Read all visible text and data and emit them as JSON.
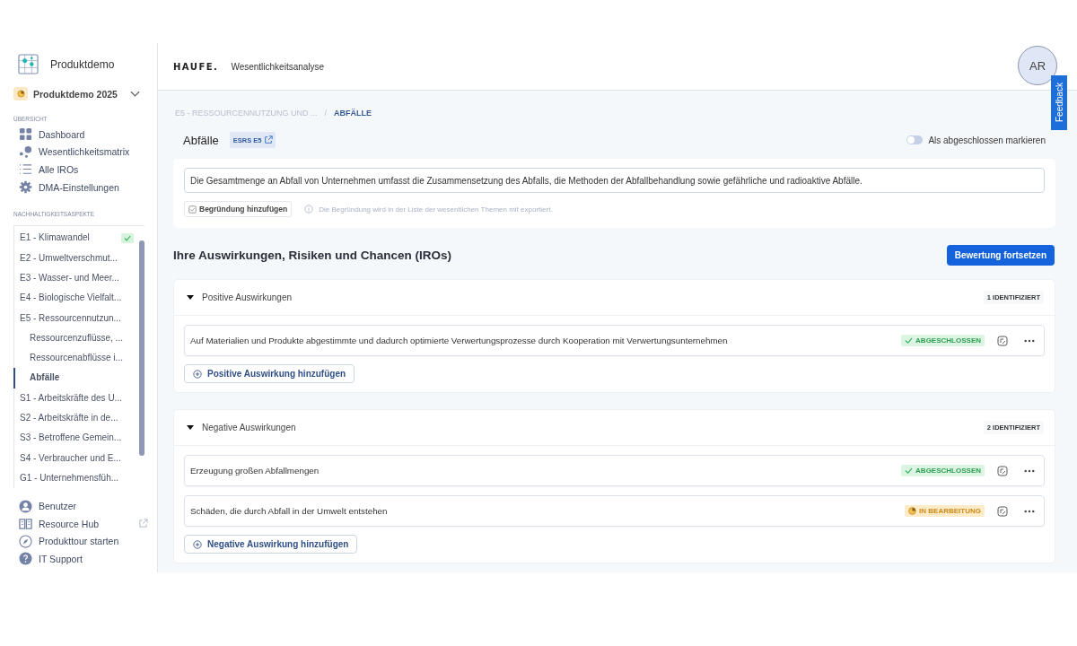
{
  "sidebar": {
    "workspace": "Produktdemo",
    "project": "Produktdemo 2025",
    "overview_heading": "ÜBERSICHT",
    "nav": [
      {
        "label": "Dashboard"
      },
      {
        "label": "Wesentlichkeitsmatrix"
      },
      {
        "label": "Alle IROs"
      },
      {
        "label": "DMA-Einstellungen"
      }
    ],
    "aspects_heading": "NACHHALTIGKEITSASPEKTE",
    "aspects": [
      {
        "label": "E1 - Klimawandel",
        "completed": true,
        "selected": false
      },
      {
        "label": "E2 - Umweltverschmut...",
        "completed": false,
        "selected": false
      },
      {
        "label": "E3 - Wasser- und Meer...",
        "completed": false,
        "selected": false
      },
      {
        "label": "E4 - Biologische Vielfalt...",
        "completed": false,
        "selected": false
      },
      {
        "label": "E5 - Ressourcennutzun...",
        "completed": false,
        "selected": false,
        "children": [
          {
            "label": "Ressourcenzuflüsse, ...",
            "selected": false
          },
          {
            "label": "Ressourcenabflüsse i...",
            "selected": false
          },
          {
            "label": "Abfälle",
            "selected": true
          }
        ]
      },
      {
        "label": "S1 - Arbeitskräfte des U...",
        "completed": false,
        "selected": false
      },
      {
        "label": "S2 - Arbeitskräfte in de...",
        "completed": false,
        "selected": false
      },
      {
        "label": "S3 - Betroffene Gemein...",
        "completed": false,
        "selected": false
      },
      {
        "label": "S4 - Verbraucher und E...",
        "completed": false,
        "selected": false
      },
      {
        "label": "G1 - Unternehmensfüh...",
        "completed": false,
        "selected": false
      }
    ],
    "footer": [
      {
        "label": "Benutzer",
        "external": false
      },
      {
        "label": "Resource Hub",
        "external": true
      },
      {
        "label": "Produkttour starten",
        "external": false
      },
      {
        "label": "IT Support",
        "external": false
      }
    ]
  },
  "header": {
    "logo": "HAUFE.",
    "app_title": "Wesentlichkeitsanalyse",
    "avatar": "AR",
    "feedback": "Feedback"
  },
  "breadcrumb": [
    "E5 - RESSOURCENNUTZUNG UND ...",
    "ABFÄLLE"
  ],
  "breadcrumb_separator": "/",
  "topic": {
    "title": "Abfälle",
    "tag": "ESRS E5",
    "toggle": {
      "label": "Als abgeschlossen markieren",
      "on": false
    },
    "description": "Die Gesamtmenge an Abfall von Unternehmen umfasst die Zusammensetzung des Abfalls, die Methoden der Abfallbehandlung sowie gefährliche und radioaktive Abfälle.",
    "reason_button": "Begründung hinzufügen",
    "reason_hint": "Die Begründung wird in der Liste der wesentlichen Themen mit exportiert."
  },
  "iros": {
    "title": "Ihre Auswirkungen, Risiken und Chancen (IROs)",
    "continue_button": "Bewertung fortsetzen",
    "groups": [
      {
        "title": "Positive Auswirkungen",
        "expanded": true,
        "count": "1 IDENTIFIZIERT",
        "add_button": "Positive Auswirkung hinzufügen",
        "items": [
          {
            "text": "Auf Materialien und Produkte abgestimmte und dadurch optimierte Verwertungsprozesse durch Kooperation mit Verwertungsunternehmen",
            "status": {
              "kind": "done",
              "label": "ABGESCHLOSSEN"
            }
          }
        ]
      },
      {
        "title": "Negative Auswirkungen",
        "expanded": true,
        "count": "2 IDENTIFIZIERT",
        "add_button": "Negative Auswirkung hinzufügen",
        "items": [
          {
            "text": "Erzeugung großen Abfallmengen",
            "status": {
              "kind": "done",
              "label": "ABGESCHLOSSEN"
            }
          },
          {
            "text": "Schäden, die durch Abfall in der Umwelt entstehen",
            "status": {
              "kind": "progress",
              "label": "IN BEARBEITUNG"
            }
          }
        ]
      }
    ]
  }
}
